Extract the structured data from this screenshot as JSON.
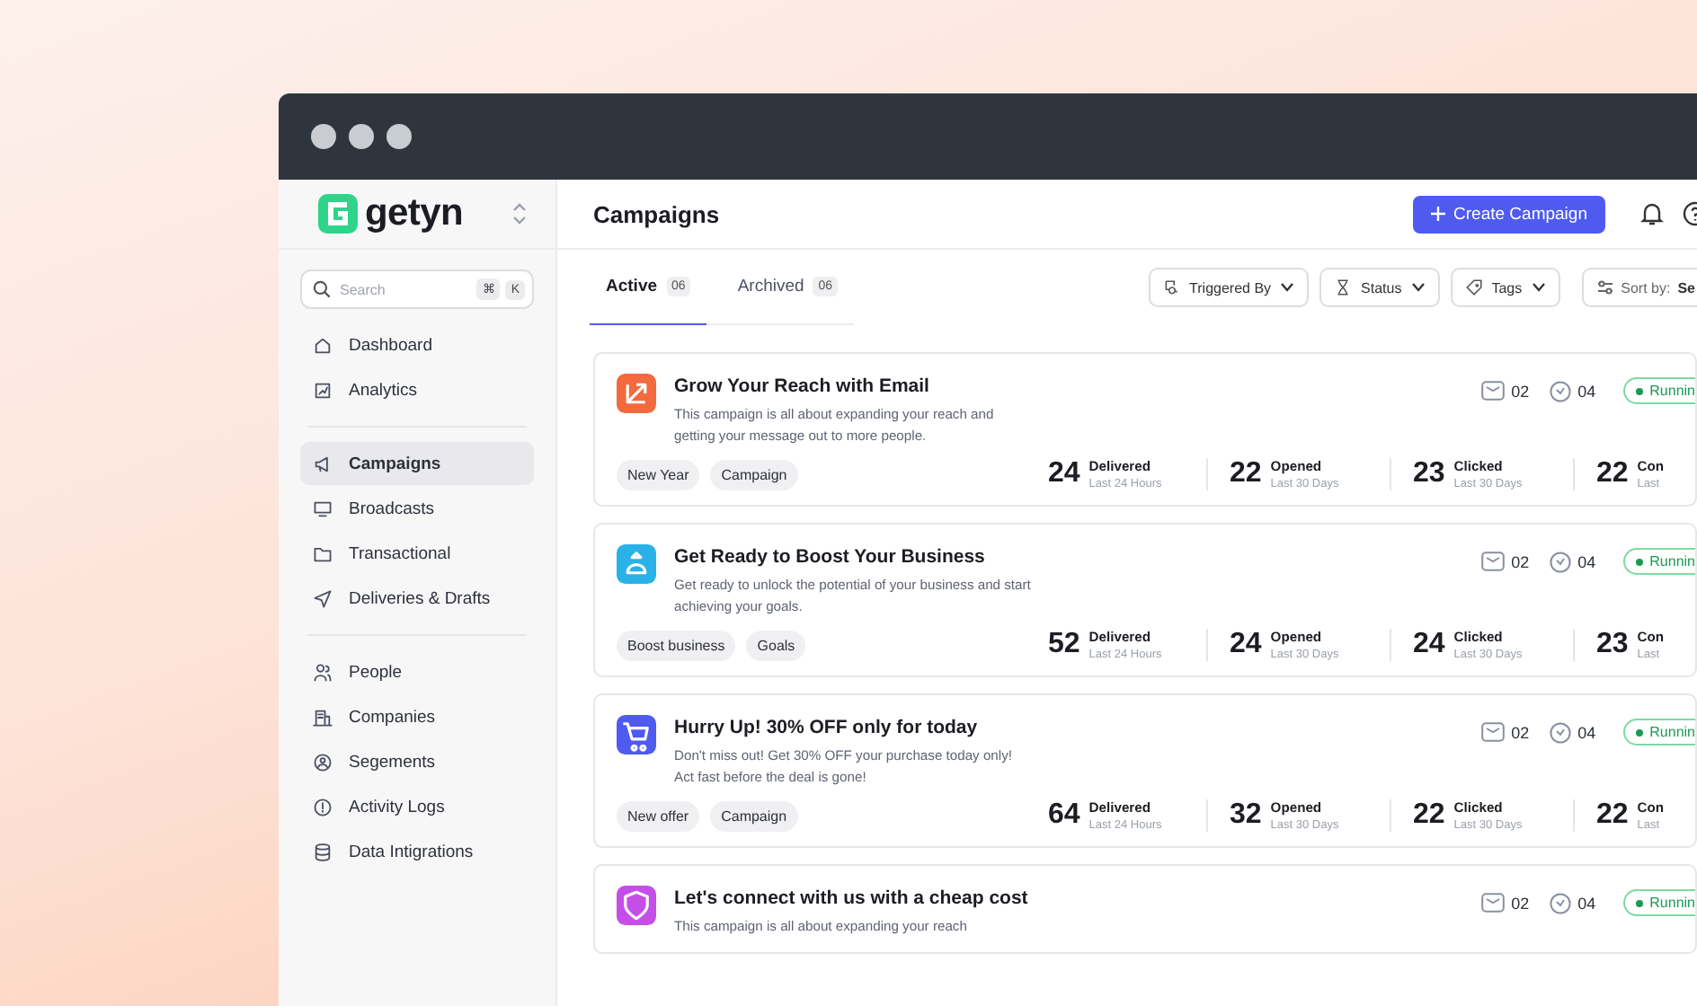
{
  "sidebar": {
    "brand": "getyn",
    "search": {
      "placeholder": "Search",
      "keys": [
        "⌘",
        "K"
      ]
    },
    "groups": [
      [
        {
          "label": "Dashboard",
          "selected": false
        },
        {
          "label": "Analytics",
          "selected": false
        }
      ],
      [
        {
          "label": "Campaigns",
          "selected": true
        },
        {
          "label": "Broadcasts",
          "selected": false
        },
        {
          "label": "Transactional",
          "selected": false
        },
        {
          "label": "Deliveries & Drafts",
          "selected": false
        }
      ],
      [
        {
          "label": "People",
          "selected": false
        },
        {
          "label": "Companies",
          "selected": false
        },
        {
          "label": "Segements",
          "selected": false
        },
        {
          "label": "Activity Logs",
          "selected": false
        },
        {
          "label": "Data Intigrations",
          "selected": false
        }
      ]
    ]
  },
  "header": {
    "title": "Campaigns",
    "create_button": "Create Campaign"
  },
  "tabs": [
    {
      "label": "Active",
      "count": "06",
      "selected": true
    },
    {
      "label": "Archived",
      "count": "06",
      "selected": false
    }
  ],
  "filters": [
    {
      "label": "Triggered By"
    },
    {
      "label": "Status"
    },
    {
      "label": "Tags"
    }
  ],
  "sort": {
    "label": "Sort by:",
    "value": "Se"
  },
  "campaigns": [
    {
      "title": "Grow Your Reach with Email",
      "description": "This campaign is all about expanding your reach and getting your message out to more people.",
      "color": "#f26a3d",
      "messages": "02",
      "timers": "04",
      "status": "Runnin",
      "tags": [
        "New Year",
        "Campaign"
      ],
      "stats": [
        {
          "value": "24",
          "label": "Delivered",
          "sub": "Last 24 Hours"
        },
        {
          "value": "22",
          "label": "Opened",
          "sub": "Last 30 Days"
        },
        {
          "value": "23",
          "label": "Clicked",
          "sub": "Last 30 Days"
        },
        {
          "value": "22",
          "label": "Con",
          "sub": "Last"
        }
      ]
    },
    {
      "title": "Get Ready to Boost Your Business",
      "description": "Get ready to unlock the potential of your business and start achieving your goals.",
      "color": "#29b2e8",
      "messages": "02",
      "timers": "04",
      "status": "Runnin",
      "tags": [
        "Boost business",
        "Goals"
      ],
      "stats": [
        {
          "value": "52",
          "label": "Delivered",
          "sub": "Last 24 Hours"
        },
        {
          "value": "24",
          "label": "Opened",
          "sub": "Last 30 Days"
        },
        {
          "value": "24",
          "label": "Clicked",
          "sub": "Last 30 Days"
        },
        {
          "value": "23",
          "label": "Con",
          "sub": "Last"
        }
      ]
    },
    {
      "title": "Hurry Up! 30% OFF only for today",
      "description": "Don't miss out! Get 30% OFF your purchase today only! Act fast before the deal is gone!",
      "color": "#4f5bf0",
      "messages": "02",
      "timers": "04",
      "status": "Runnin",
      "tags": [
        "New offer",
        "Campaign"
      ],
      "stats": [
        {
          "value": "64",
          "label": "Delivered",
          "sub": "Last 24 Hours"
        },
        {
          "value": "32",
          "label": "Opened",
          "sub": "Last 30 Days"
        },
        {
          "value": "22",
          "label": "Clicked",
          "sub": "Last 30 Days"
        },
        {
          "value": "22",
          "label": "Con",
          "sub": "Last"
        }
      ]
    },
    {
      "title": "Let's connect with us with a cheap cost",
      "description": "This campaign is all about expanding your reach",
      "color": "#c64ee8",
      "messages": "02",
      "timers": "04",
      "status": "Runnin"
    }
  ]
}
